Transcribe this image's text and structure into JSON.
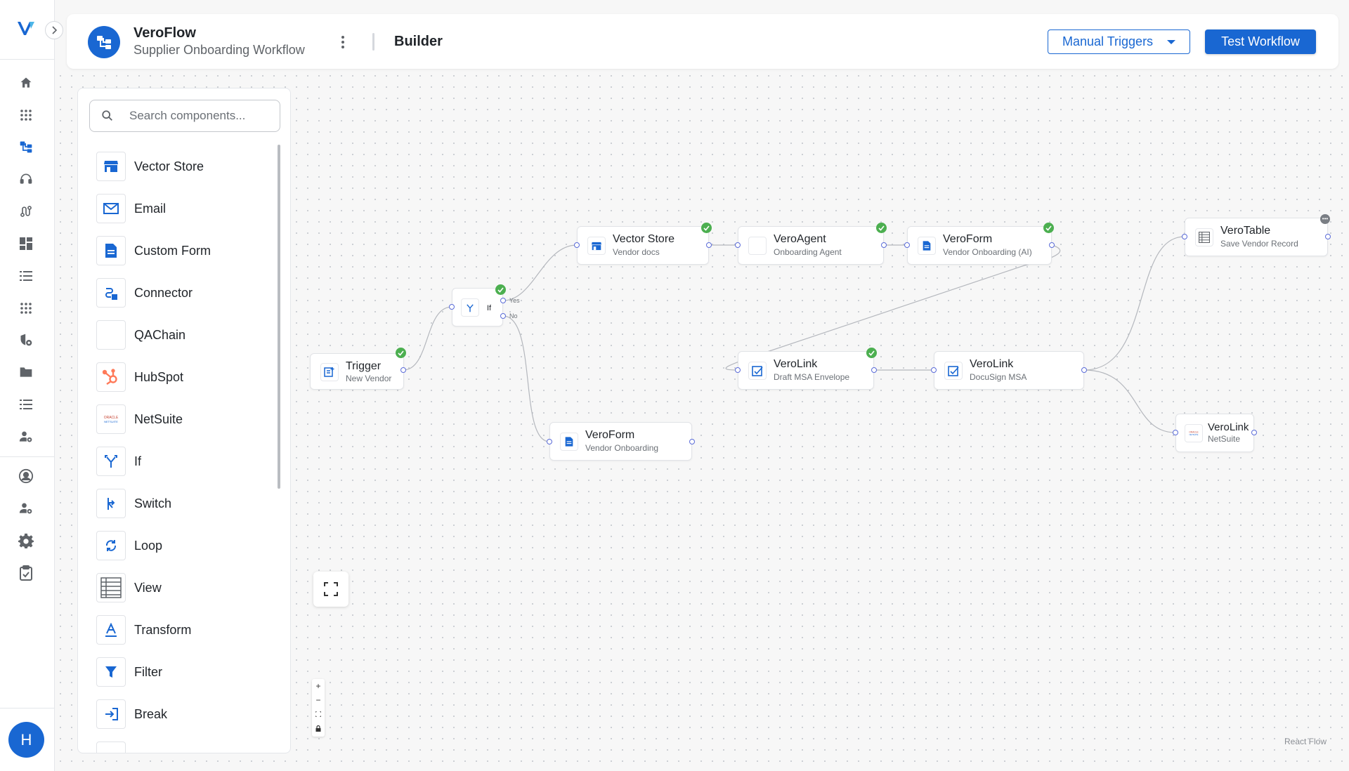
{
  "app": {
    "name": "VeroFlow",
    "workflow_name": "Supplier Onboarding Workflow",
    "view": "Builder"
  },
  "header": {
    "triggers_label": "Manual Triggers",
    "test_label": "Test Workflow"
  },
  "user": {
    "initial": "H"
  },
  "colors": {
    "brand": "#1967d2",
    "success": "#4caf50",
    "handle": "#5a6bd8"
  },
  "rail": {
    "icons": [
      "home-icon",
      "apps-grid-icon",
      "workflow-icon",
      "headset-icon",
      "route-icon",
      "dashboard-icon",
      "list-icon",
      "apps-grid-icon",
      "shield-gear-icon",
      "folder-icon",
      "list-icon",
      "user-gear-icon",
      "account-circle-icon",
      "user-gear-icon",
      "settings-icon",
      "clipboard-check-icon"
    ]
  },
  "search": {
    "placeholder": "Search components..."
  },
  "components": [
    {
      "label": "Vector Store",
      "icon": "vector-store-icon"
    },
    {
      "label": "Email",
      "icon": "email-icon"
    },
    {
      "label": "Custom Form",
      "icon": "form-icon"
    },
    {
      "label": "Connector",
      "icon": "connector-icon"
    },
    {
      "label": "QAChain",
      "icon": "qachain-icon"
    },
    {
      "label": "HubSpot",
      "icon": "hubspot-icon"
    },
    {
      "label": "NetSuite",
      "icon": "netsuite-icon"
    },
    {
      "label": "If",
      "icon": "branch-icon"
    },
    {
      "label": "Switch",
      "icon": "switch-icon"
    },
    {
      "label": "Loop",
      "icon": "loop-icon"
    },
    {
      "label": "View",
      "icon": "table-icon"
    },
    {
      "label": "Transform",
      "icon": "transform-icon"
    },
    {
      "label": "Filter",
      "icon": "filter-icon"
    },
    {
      "label": "Break",
      "icon": "break-icon"
    }
  ],
  "nodes": {
    "trigger": {
      "title": "Trigger",
      "subtitle": "New Vendor"
    },
    "if": {
      "title": "If",
      "yes": "Yes",
      "no": "No"
    },
    "vector_store": {
      "title": "Vector Store",
      "subtitle": "Vendor docs"
    },
    "agent": {
      "title": "VeroAgent",
      "subtitle": "Onboarding Agent"
    },
    "form_ai": {
      "title": "VeroForm",
      "subtitle": "Vendor Onboarding (AI)"
    },
    "table": {
      "title": "VeroTable",
      "subtitle": "Save Vendor Record"
    },
    "link_draft": {
      "title": "VeroLink",
      "subtitle": "Draft MSA Envelope"
    },
    "link_docusign": {
      "title": "VeroLink",
      "subtitle": "DocuSign MSA"
    },
    "link_netsuite": {
      "title": "VeroLink",
      "subtitle": "NetSuite"
    },
    "form_manual": {
      "title": "VeroForm",
      "subtitle": "Vendor Onboarding"
    }
  },
  "zoom_controls": [
    "+",
    "−"
  ],
  "attribution": "React Flow",
  "netsuite_logo_text": "ORACLE NETSUITE"
}
